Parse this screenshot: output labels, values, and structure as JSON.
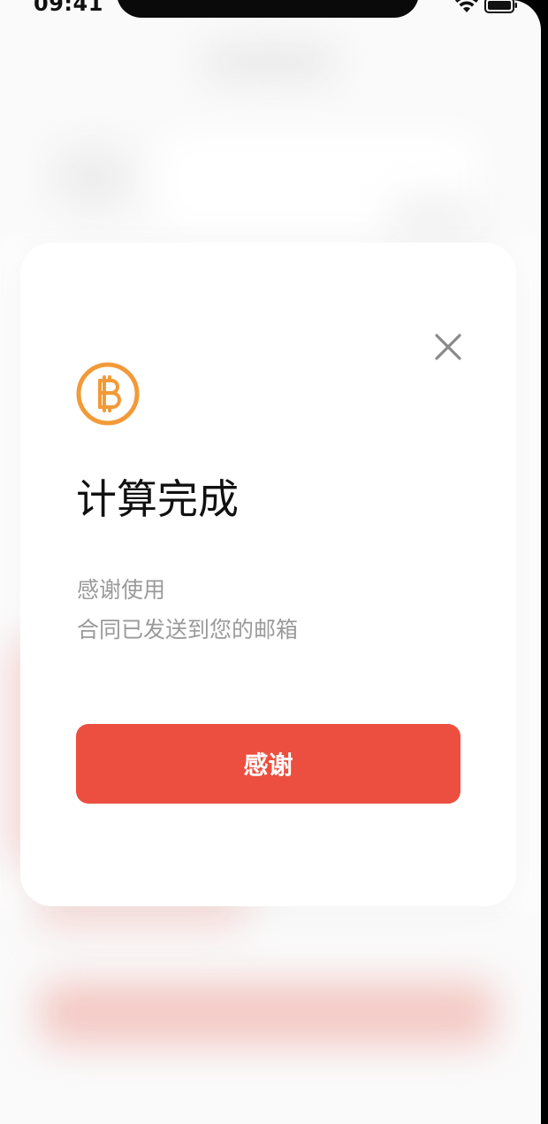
{
  "status_bar": {
    "time": "09:41"
  },
  "dialog": {
    "icon": "bitcoin-coin-icon",
    "close_icon": "close-icon",
    "title": "计算完成",
    "message_line1": "感谢使用",
    "message_line2": "合同已发送到您的邮箱",
    "button_label": "感谢"
  },
  "colors": {
    "accent": "#ec4f3f",
    "coin": "#f29a38",
    "muted_text": "#9a9a9a"
  }
}
